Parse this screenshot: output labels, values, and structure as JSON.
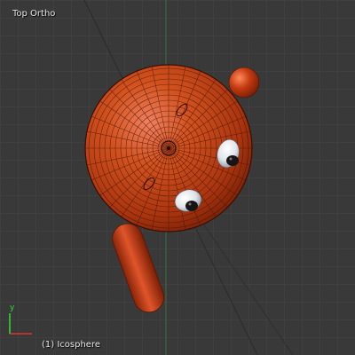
{
  "viewport": {
    "view_label": "Top Ortho",
    "object_label": "(1) Icosphere"
  },
  "axis_gizmo": {
    "y_label": "y",
    "x_color": "#dd3333",
    "y_color": "#33dd33"
  },
  "colors": {
    "background": "#393939",
    "grid": "#474747",
    "x_axis_line": "#7a3a3a",
    "y_axis_line": "#3f6b3f",
    "mesh_body": "#c0401c"
  },
  "scene_objects": [
    {
      "name": "Icosphere",
      "type": "sphere-mesh"
    },
    {
      "name": "small-sphere",
      "type": "sphere"
    },
    {
      "name": "eye-right",
      "type": "eye"
    },
    {
      "name": "eye-lower",
      "type": "eye"
    },
    {
      "name": "capsule",
      "type": "capsule"
    }
  ]
}
